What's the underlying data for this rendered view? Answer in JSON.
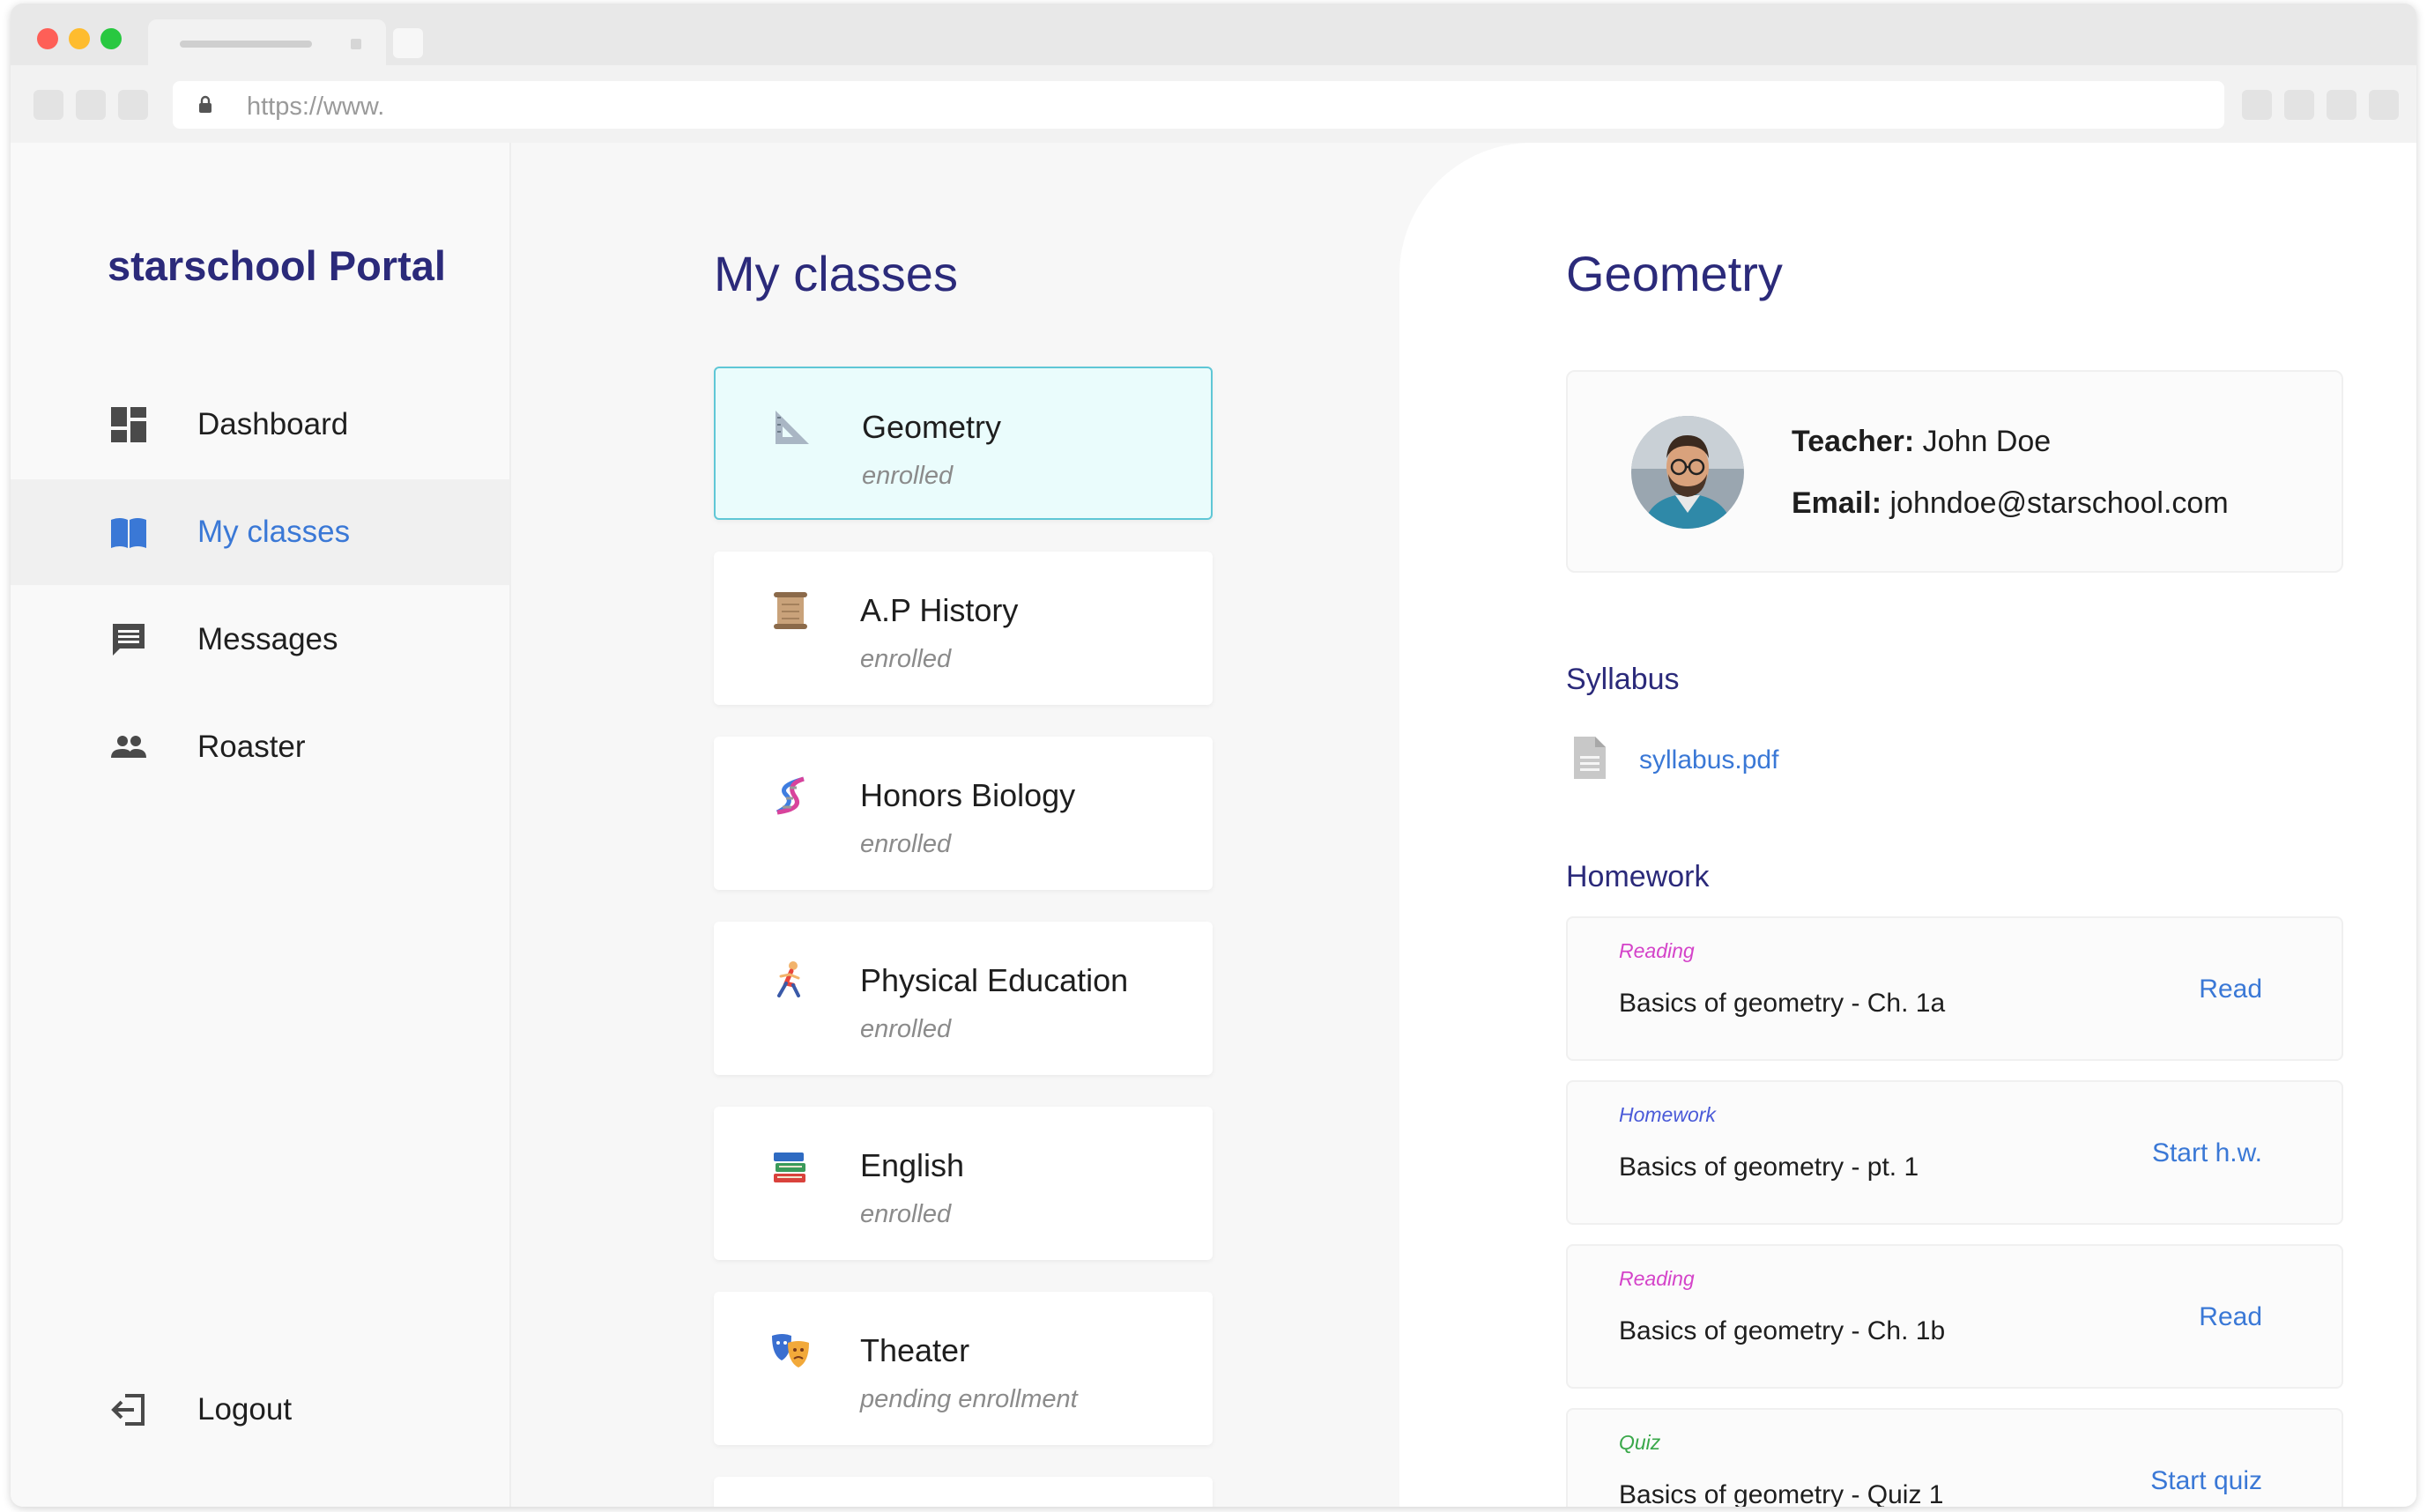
{
  "browser": {
    "url": "https://www."
  },
  "sidebar": {
    "brand": "starschool Portal",
    "items": [
      {
        "label": "Dashboard",
        "icon": "dashboard-icon"
      },
      {
        "label": "My classes",
        "icon": "book-icon",
        "active": true
      },
      {
        "label": "Messages",
        "icon": "message-icon"
      },
      {
        "label": "Roaster",
        "icon": "people-icon"
      }
    ],
    "logout": {
      "label": "Logout",
      "icon": "logout-icon"
    }
  },
  "classes": {
    "title": "My classes",
    "items": [
      {
        "name": "Geometry",
        "status": "enrolled",
        "icon": "triangle-ruler-icon",
        "selected": true
      },
      {
        "name": "A.P History",
        "status": "enrolled",
        "icon": "scroll-icon"
      },
      {
        "name": "Honors Biology",
        "status": "enrolled",
        "icon": "dna-icon"
      },
      {
        "name": "Physical Education",
        "status": "enrolled",
        "icon": "runner-icon"
      },
      {
        "name": "English",
        "status": "enrolled",
        "icon": "books-icon"
      },
      {
        "name": "Theater",
        "status": "pending enrollment",
        "icon": "theater-masks-icon"
      }
    ]
  },
  "detail": {
    "title": "Geometry",
    "teacher": {
      "teacher_key": "Teacher:",
      "teacher_name": "John Doe",
      "email_key": "Email:",
      "email": "johndoe@starschool.com"
    },
    "syllabus": {
      "heading": "Syllabus",
      "file": "syllabus.pdf"
    },
    "homework": {
      "heading": "Homework",
      "items": [
        {
          "type": "Reading",
          "type_color": "#d443c9",
          "title": "Basics of geometry - Ch. 1a",
          "action": "Read"
        },
        {
          "type": "Homework",
          "type_color": "#4a5ad8",
          "title": "Basics of geometry - pt. 1",
          "action": "Start h.w."
        },
        {
          "type": "Reading",
          "type_color": "#d443c9",
          "title": "Basics of geometry - Ch. 1b",
          "action": "Read"
        },
        {
          "type": "Quiz",
          "type_color": "#3aa84a",
          "title": "Basics of geometry - Quiz 1",
          "action": "Start quiz"
        }
      ]
    }
  },
  "colors": {
    "brand": "#2b2a7a",
    "accent": "#3a78d6",
    "selected_bg": "#eafcfc",
    "selected_border": "#5fc7d6"
  }
}
